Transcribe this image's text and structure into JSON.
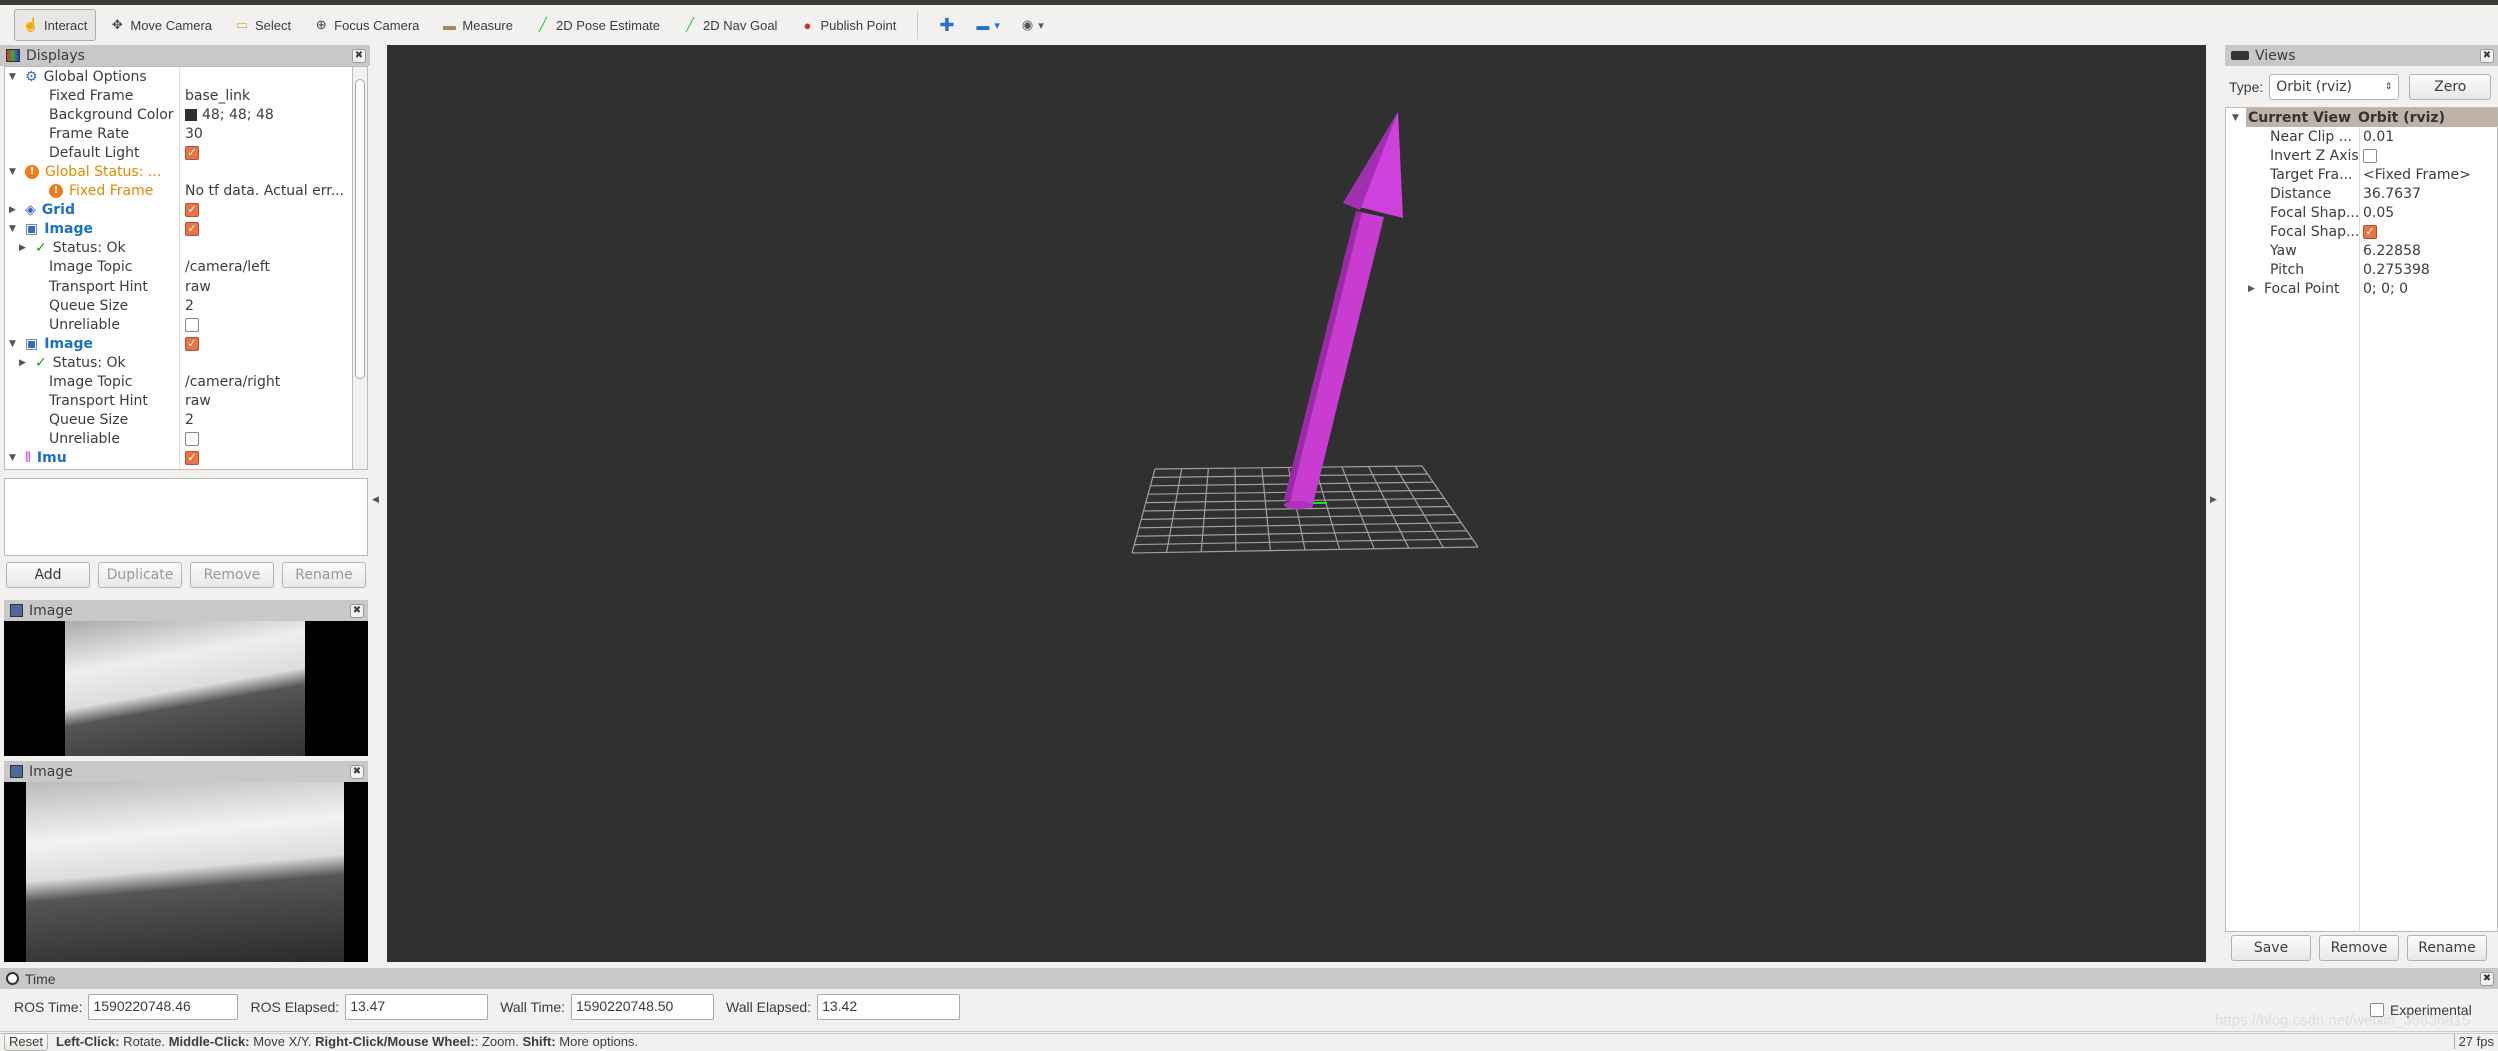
{
  "toolbar": {
    "items": [
      {
        "label": "Interact",
        "icon": "hand-pointer-icon"
      },
      {
        "label": "Move Camera",
        "icon": "move-arrows-icon"
      },
      {
        "label": "Select",
        "icon": "select-box-icon"
      },
      {
        "label": "Focus Camera",
        "icon": "crosshair-icon"
      },
      {
        "label": "Measure",
        "icon": "ruler-icon"
      },
      {
        "label": "2D Pose Estimate",
        "icon": "green-arrow-icon"
      },
      {
        "label": "2D Nav Goal",
        "icon": "green-arrow-icon"
      },
      {
        "label": "Publish Point",
        "icon": "map-pin-icon"
      }
    ]
  },
  "displays": {
    "title": "Displays",
    "rows": [
      {
        "indent": 0,
        "arrow": "▼",
        "icon": "⚙",
        "key": "Global Options",
        "style": "",
        "value": ""
      },
      {
        "indent": 1,
        "arrow": "",
        "icon": "",
        "key": "Fixed Frame",
        "style": "",
        "value": "base_link"
      },
      {
        "indent": 1,
        "arrow": "",
        "icon": "",
        "key": "Background Color",
        "style": "",
        "value": "48; 48; 48",
        "swatch": "#303030"
      },
      {
        "indent": 1,
        "arrow": "",
        "icon": "",
        "key": "Frame Rate",
        "style": "",
        "value": "30"
      },
      {
        "indent": 1,
        "arrow": "",
        "icon": "",
        "key": "Default Light",
        "style": "",
        "check": true
      },
      {
        "indent": 0,
        "arrow": "▼",
        "icon": "!",
        "key": "Global Status: ...",
        "style": "orange",
        "value": ""
      },
      {
        "indent": 1,
        "arrow": "",
        "icon": "!",
        "key": "Fixed Frame",
        "style": "orange",
        "value": "No tf data.  Actual err..."
      },
      {
        "indent": 0,
        "arrow": "▶",
        "icon": "◈",
        "key": "Grid",
        "style": "blue",
        "check": true
      },
      {
        "indent": 0,
        "arrow": "▼",
        "icon": "▣",
        "key": "Image",
        "style": "blue",
        "check": true
      },
      {
        "indent": 1,
        "arrow": "▶",
        "icon": "✓",
        "key": "Status: Ok",
        "style": "",
        "value": ""
      },
      {
        "indent": 1,
        "arrow": "",
        "icon": "",
        "key": "Image Topic",
        "style": "",
        "value": "/camera/left"
      },
      {
        "indent": 1,
        "arrow": "",
        "icon": "",
        "key": "Transport Hint",
        "style": "",
        "value": "raw"
      },
      {
        "indent": 1,
        "arrow": "",
        "icon": "",
        "key": "Queue Size",
        "style": "",
        "value": "2"
      },
      {
        "indent": 1,
        "arrow": "",
        "icon": "",
        "key": "Unreliable",
        "style": "",
        "check": false
      },
      {
        "indent": 0,
        "arrow": "▼",
        "icon": "▣",
        "key": "Image",
        "style": "blue",
        "check": true
      },
      {
        "indent": 1,
        "arrow": "▶",
        "icon": "✓",
        "key": "Status: Ok",
        "style": "",
        "value": ""
      },
      {
        "indent": 1,
        "arrow": "",
        "icon": "",
        "key": "Image Topic",
        "style": "",
        "value": "/camera/right"
      },
      {
        "indent": 1,
        "arrow": "",
        "icon": "",
        "key": "Transport Hint",
        "style": "",
        "value": "raw"
      },
      {
        "indent": 1,
        "arrow": "",
        "icon": "",
        "key": "Queue Size",
        "style": "",
        "value": "2"
      },
      {
        "indent": 1,
        "arrow": "",
        "icon": "",
        "key": "Unreliable",
        "style": "",
        "check": false
      },
      {
        "indent": 0,
        "arrow": "▼",
        "icon": "⫴",
        "key": "Imu",
        "style": "blue",
        "check": true
      }
    ],
    "buttons": {
      "add": "Add",
      "duplicate": "Duplicate",
      "remove": "Remove",
      "rename": "Rename"
    }
  },
  "image_panels": [
    {
      "title": "Image"
    },
    {
      "title": "Image"
    }
  ],
  "views": {
    "title": "Views",
    "type_label": "Type:",
    "type_value": "Orbit (rviz)",
    "zero": "Zero",
    "header": {
      "key": "Current View",
      "value": "Orbit (rviz)"
    },
    "rows": [
      {
        "key": "Near Clip ...",
        "value": "0.01"
      },
      {
        "key": "Invert Z Axis",
        "check": false
      },
      {
        "key": "Target Fra...",
        "value": "<Fixed Frame>"
      },
      {
        "key": "Distance",
        "value": "36.7637"
      },
      {
        "key": "Focal Shap...",
        "value": "0.05"
      },
      {
        "key": "Focal Shap...",
        "check": true
      },
      {
        "key": "Yaw",
        "value": "6.22858"
      },
      {
        "key": "Pitch",
        "value": "0.275398"
      },
      {
        "key": "Focal Point",
        "value": "0; 0; 0",
        "arrow": "▶"
      }
    ],
    "buttons": {
      "save": "Save",
      "remove": "Remove",
      "rename": "Rename"
    }
  },
  "time": {
    "title": "Time",
    "ros_time_label": "ROS Time:",
    "ros_time": "1590220748.46",
    "ros_elapsed_label": "ROS Elapsed:",
    "ros_elapsed": "13.47",
    "wall_time_label": "Wall Time:",
    "wall_time": "1590220748.50",
    "wall_elapsed_label": "Wall Elapsed:",
    "wall_elapsed": "13.42",
    "experimental": "Experimental"
  },
  "status": {
    "reset": "Reset",
    "help_b1": "Left-Click:",
    "help_t1": " Rotate. ",
    "help_b2": "Middle-Click:",
    "help_t2": " Move X/Y. ",
    "help_b3": "Right-Click/Mouse Wheel:",
    "help_t3": ": Zoom. ",
    "help_b4": "Shift:",
    "help_t4": " More options.",
    "fps": "27 fps",
    "watermark": "https://blog.csdn.net/weixin_38636815"
  },
  "scene": {
    "background": "#303030",
    "arrow_color": "#c83cd2",
    "grid_color": "#a0a0a0",
    "grid_cells": 10
  }
}
